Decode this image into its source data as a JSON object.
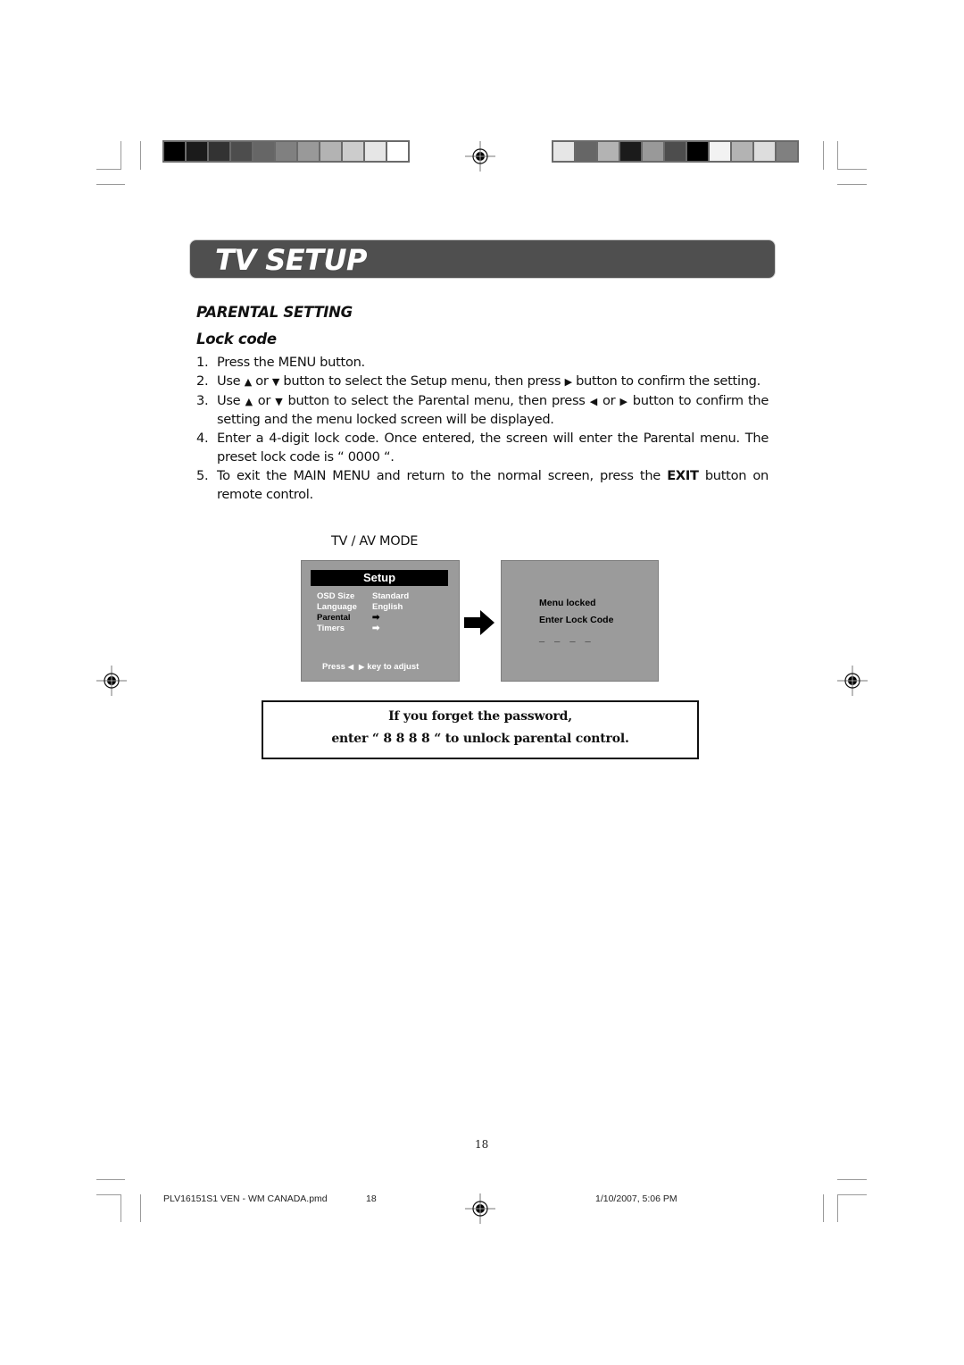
{
  "print_marks": {
    "colorbar_left": [
      "#000000",
      "#1b1b1b",
      "#333333",
      "#4d4d4d",
      "#666666",
      "#808080",
      "#999999",
      "#b3b3b3",
      "#cccccc",
      "#e6e6e6",
      "#ffffff"
    ],
    "colorbar_right": [
      "#e6e6e6",
      "#666666",
      "#b3b3b3",
      "#1b1b1b",
      "#999999",
      "#4d4d4d",
      "#000000",
      "#f2f2f2",
      "#b3b3b3",
      "#dddddd",
      "#808080"
    ]
  },
  "header": {
    "title": "TV SETUP"
  },
  "section": {
    "title": "PARENTAL SETTING",
    "subtitle": "Lock code"
  },
  "steps": [
    {
      "num": "1.",
      "text": "Press the MENU button."
    },
    {
      "num": "2.",
      "parts": [
        "Use ",
        "▲",
        " or ",
        "▼",
        " button to select the Setup menu, then press ",
        "▶",
        " button to confirm the setting."
      ]
    },
    {
      "num": "3.",
      "parts": [
        "Use ",
        "▲",
        " or ",
        "▼",
        " button to select the Parental menu, then press ",
        "◀",
        " or ",
        "▶",
        " button to confirm the setting and the menu locked screen will be displayed."
      ]
    },
    {
      "num": "4.",
      "text": "Enter a 4-digit lock code. Once entered, the screen will enter the Parental menu. The preset lock code is “ 0000 “."
    },
    {
      "num": "5.",
      "pre": "To exit the MAIN MENU and return to the normal screen, press the ",
      "bold": "EXIT",
      "post": " button on remote control."
    }
  ],
  "mode_label": "TV / AV MODE",
  "osd_setup": {
    "title": "Setup",
    "rows": [
      {
        "key": "OSD Size",
        "value": "Standard",
        "selected": false
      },
      {
        "key": "Language",
        "value": "English",
        "selected": false
      },
      {
        "key": "Parental",
        "value": "➡",
        "selected": true
      },
      {
        "key": "Timers",
        "value": "➡",
        "selected": false
      }
    ],
    "footer_pre": "Press",
    "footer_left_icon": "◀",
    "footer_right_icon": "▶",
    "footer_post": "key to adjust"
  },
  "osd_locked": {
    "line1": "Menu locked",
    "line2": "Enter Lock Code",
    "code_placeholder": "_ _ _ _"
  },
  "notice": {
    "line1": "If you forget the password,",
    "line2": "enter “ 8 8 8 8 “ to unlock parental control."
  },
  "page_number": "18",
  "footer": {
    "file": "PLV16151S1 VEN - WM CANADA.pmd",
    "page": "18",
    "datetime": "1/10/2007, 5:06 PM"
  }
}
